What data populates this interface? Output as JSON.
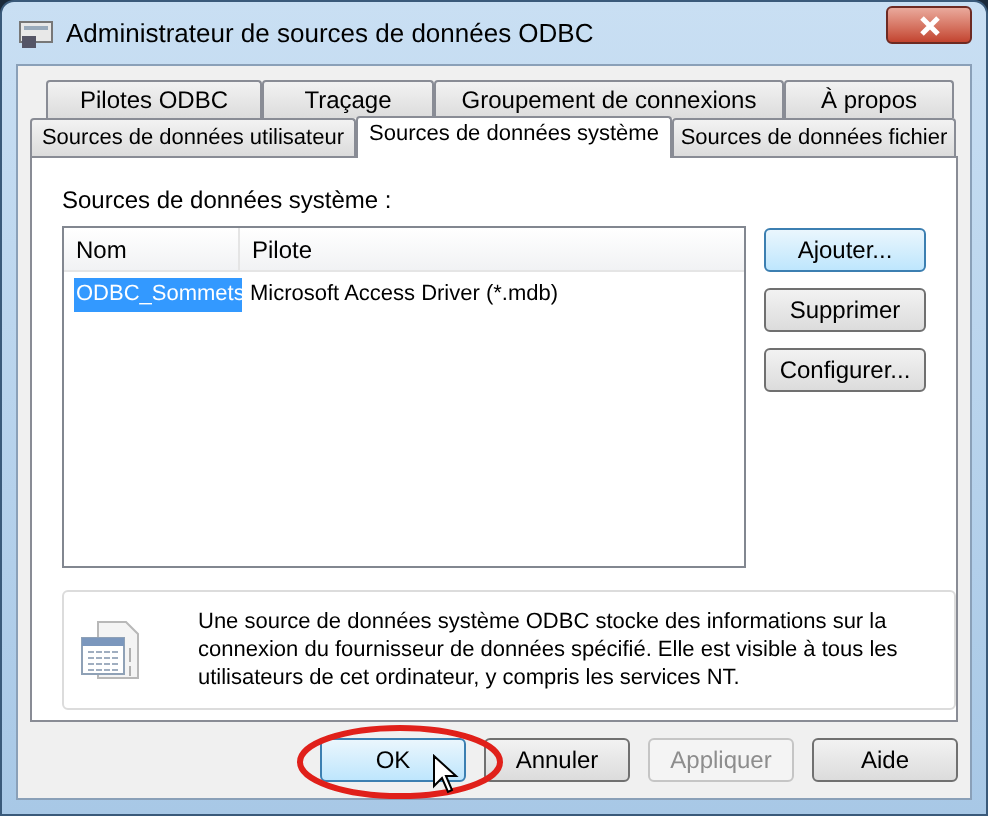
{
  "window": {
    "title": "Administrateur de sources de données ODBC"
  },
  "tab_rows": [
    [
      {
        "label": "Pilotes ODBC",
        "selected": false
      },
      {
        "label": "Traçage",
        "selected": false
      },
      {
        "label": "Groupement de connexions",
        "selected": false
      },
      {
        "label": "À propos",
        "selected": false
      }
    ],
    [
      {
        "label": "Sources de données utilisateur",
        "selected": false
      },
      {
        "label": "Sources de données système",
        "selected": true
      },
      {
        "label": "Sources de données fichier",
        "selected": false
      }
    ]
  ],
  "panel": {
    "list_label": "Sources de données système :",
    "list": {
      "columns": [
        "Nom",
        "Pilote"
      ],
      "rows": [
        {
          "cells": [
            "ODBC_Sommets",
            "Microsoft Access Driver (*.mdb)"
          ],
          "selected": true
        }
      ]
    },
    "side_buttons": [
      {
        "label": "Ajouter...",
        "highlighted": true,
        "disabled": false
      },
      {
        "label": "Supprimer",
        "highlighted": false,
        "disabled": false
      },
      {
        "label": "Configurer...",
        "highlighted": false,
        "disabled": false
      }
    ],
    "info": "Une source de données système ODBC stocke des informations sur la connexion du fournisseur de données spécifié. Elle est visible à tous les utilisateurs de cet ordinateur, y compris les services NT."
  },
  "buttons": [
    {
      "label": "OK",
      "highlighted": true,
      "disabled": false
    },
    {
      "label": "Annuler",
      "highlighted": false,
      "disabled": false
    },
    {
      "label": "Appliquer",
      "highlighted": false,
      "disabled": true
    },
    {
      "label": "Aide",
      "highlighted": false,
      "disabled": false
    }
  ]
}
